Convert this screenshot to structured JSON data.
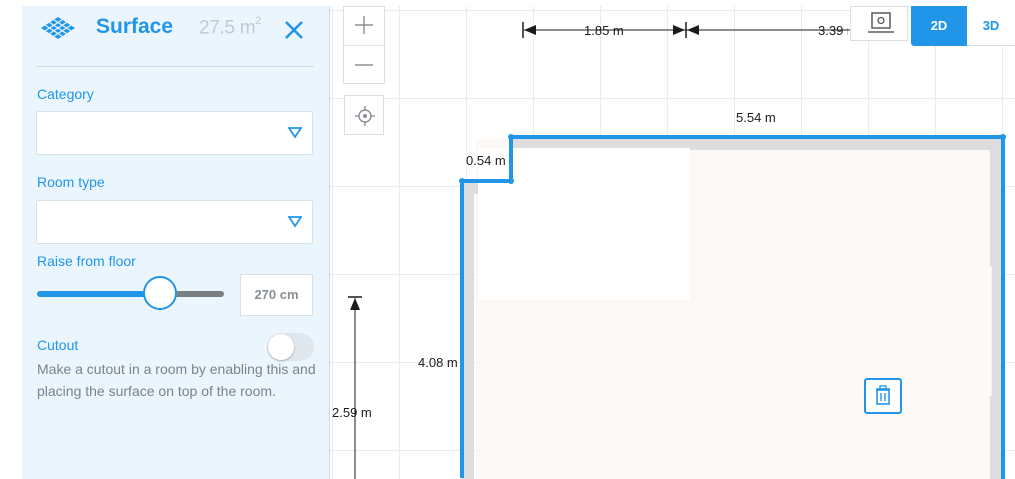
{
  "panel": {
    "title": "Surface",
    "area_value": "27.5 m",
    "area_unit_sup": "2",
    "category": {
      "label": "Category",
      "value": ""
    },
    "room_type": {
      "label": "Room type",
      "value": ""
    },
    "raise_from_floor": {
      "label": "Raise from floor",
      "value": "270 cm",
      "slider_fraction": 0.74
    },
    "cutout": {
      "label": "Cutout",
      "enabled": false,
      "description": "Make a cutout in a room by enabling this and placing the surface on top of the room."
    }
  },
  "toolbar": {
    "view_2d_label": "2D",
    "view_3d_label": "3D",
    "active_view": "2D"
  },
  "dimensions": {
    "top_left": "1.85 m",
    "top_right": "3.39 m",
    "room_top": "5.54 m",
    "notch": "0.54 m",
    "left_wall": "4.08 m",
    "left_measure": "2.59 m"
  },
  "colors": {
    "accent": "#2196e9",
    "panel_bg": "#ebf5fd",
    "floor_fill": "#fcf8f6"
  },
  "icons": [
    "surface-grid-icon",
    "close-icon",
    "chevron-down-icon",
    "zoom-in-icon",
    "zoom-out-icon",
    "locate-icon",
    "view-settings-icon",
    "trash-icon"
  ]
}
